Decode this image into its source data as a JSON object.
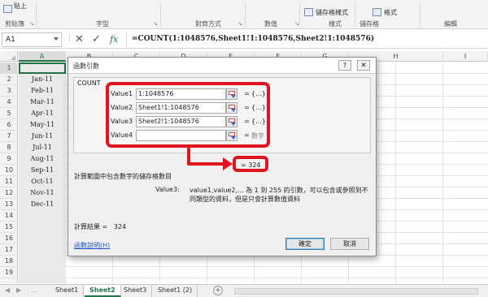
{
  "ribbon": {
    "paste_fragment": "貼上",
    "clipboard_label": "剪貼簿",
    "font_label": "字型",
    "alignment_label": "對齊方式",
    "number_label": "數值",
    "styles_fragment": "儲存格樣式",
    "styles_label": "樣式",
    "cells_label": "儲存格",
    "format_fragment": "格式",
    "editing_label": "編輯"
  },
  "formula_bar": {
    "name_box": "A1",
    "fx_label": "fx",
    "formula": "=COUNT(1:1048576,Sheet1!1:1048576,Sheet2!1:1048576)"
  },
  "grid": {
    "columns": [
      "A",
      "B",
      "C",
      "D",
      "E",
      "F",
      "G",
      "H",
      "I"
    ],
    "rows": [
      "1",
      "2",
      "3",
      "4",
      "5",
      "6",
      "7",
      "8",
      "9",
      "10",
      "11",
      "12",
      "13",
      "14",
      "15",
      "16",
      "17",
      "18",
      "19"
    ],
    "colA_values": [
      "",
      "Jan-11",
      "Feb-11",
      "Mar-11",
      "Apr-11",
      "May-11",
      "Jun-11",
      "Jul-11",
      "Aug-11",
      "Sep-11",
      "Oct-11",
      "Nov-11",
      "Dec-11"
    ]
  },
  "sheet_tabs": {
    "tabs": [
      "Sheet1",
      "Sheet2",
      "Sheet3",
      "Sheet1 (2)"
    ],
    "active": "Sheet2",
    "nav_prev": "◀",
    "nav_next": "▶",
    "more": "...",
    "add": "+"
  },
  "dialog": {
    "title": "函數引數",
    "help_button": "?",
    "close_button": "✕",
    "function_name": "COUNT",
    "args": [
      {
        "label": "Value1",
        "value": "1:1048576",
        "result": "{...}"
      },
      {
        "label": "Value2",
        "value": "Sheet1!1:1048576",
        "result": "{...}"
      },
      {
        "label": "Value3",
        "value": "Sheet2!1:1048576",
        "result": "{...}"
      },
      {
        "label": "Value4",
        "value": "",
        "result": "數字"
      }
    ],
    "equals": "=",
    "formula_result": "=   324",
    "description": "計算範圍中包含數字的儲存格數目",
    "arg_name": "Value3:",
    "arg_description": "value1,value2,... 為 1 到 255 的引數，可以包含或參照到不同類型的資料，但是只會計算數值資料",
    "calc_result_label": "計算結果 =",
    "calc_result_value": "324",
    "help_link": "函數說明(H)",
    "ok_button": "確定",
    "cancel_button": "取消"
  },
  "colors": {
    "accent": "#217346",
    "highlight_red": "#e0141e",
    "link_blue": "#1f57c3"
  }
}
